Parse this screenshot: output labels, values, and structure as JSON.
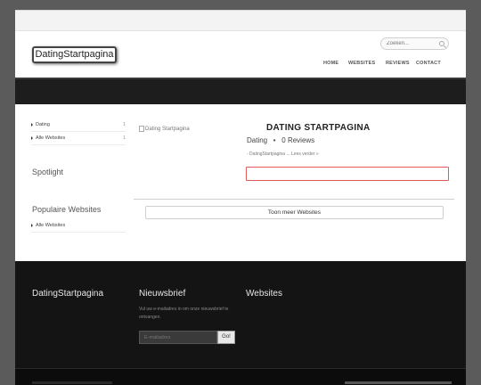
{
  "header": {
    "logo_text": "DatingStartpagina",
    "search_placeholder": "Zoeken...",
    "nav": [
      "HOME",
      "WEBSITES",
      "REVIEWS",
      "CONTACT"
    ]
  },
  "sidebar": {
    "categories": [
      {
        "label": "Dating",
        "count": "1"
      },
      {
        "label": "Alle Websites",
        "count": "1"
      }
    ],
    "spotlight_title": "Spotlight",
    "popular_title": "Populaire Websites",
    "popular_items": [
      {
        "label": "Alle Websites"
      }
    ]
  },
  "main": {
    "image_alt": "Dating Startpagina",
    "post_title": "DATING STARTPAGINA",
    "category": "Dating",
    "separator": "•",
    "reviews": "0 Reviews",
    "excerpt": "- DatingStartpagina ... Lees verder »",
    "more_button": "Toon meer Websites"
  },
  "footer": {
    "col1_title": "DatingStartpagina",
    "col2_title": "Nieuwsbrief",
    "newsletter_text": "Vul uw e-mailadres in om onze nieuwsbrief te ontvangen.",
    "email_placeholder": "E-mailadres",
    "go_label": "Go!",
    "col3_title": "Websites"
  }
}
